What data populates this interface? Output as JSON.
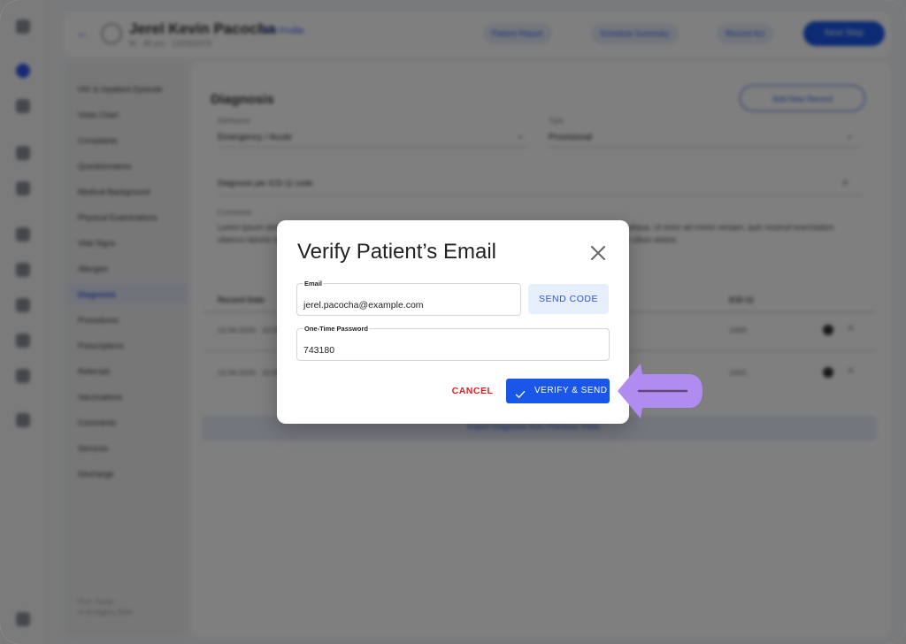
{
  "background": {
    "patient_name": "Jerel Kevin Pacocha",
    "patient_meta": "M · 45 yrs · 12/03/1979",
    "visit_chip": "Visit Profile",
    "header_buttons": [
      "Patient Report",
      "Schedule Summary",
      "Record Act"
    ],
    "primary_button": "Next Step",
    "nav_items": [
      "HIV & Inpatient Episode",
      "Visits Chart",
      "Complaints",
      "Questionnaires",
      "Medical Background",
      "Physical Examinations",
      "Vital Signs",
      "Allergies",
      "Diagnosis",
      "Procedures",
      "Prescriptions",
      "Referrals",
      "Vaccinations",
      "Comments",
      "Services",
      "Discharge"
    ],
    "nav_selected": "Diagnosis",
    "nav_footer": [
      "Prof. Portal",
      "© All Rights 2024"
    ],
    "main_title": "Diagnosis",
    "add_button": "Add New Record",
    "field1_label": "Admission",
    "field1_value": "Emergency / Acute",
    "field2_label": "Type",
    "field2_value": "Provisional",
    "search_text": "Diagnosis per ICD-11 code",
    "comments_label": "Comments",
    "comments_text": "Lorem ipsum dolor sit amet, consectetur adipiscing elit, sed do eiusmod tempor incididunt ut labore et dolore magna aliqua. Ut enim ad minim veniam, quis nostrud exercitation ullamco laboris nisi ut aliquip ex ea commodo consequat. Duis aute irure dolor in reprehenderit in voluptate velit esse cillum dolore.",
    "table_headers": [
      "Record Date",
      "ICD-11"
    ],
    "table_rows": [
      [
        "12.04.2024 · 10:32",
        "1A00"
      ],
      [
        "12.04.2024 · 10:40",
        "1A01"
      ]
    ],
    "band_text": "Import Diagnosis from Previous Visits"
  },
  "dialog": {
    "title": "Verify Patient’s Email",
    "email_label": "Email",
    "email_value": "jerel.pacocha@example.com",
    "send_code_label": "SEND CODE",
    "otp_label": "One-Time Password",
    "otp_value": "743180",
    "cancel_label": "CANCEL",
    "verify_label": "VERIFY & SEND",
    "icons": {
      "close": "close-icon",
      "confirm": "check-icon",
      "callout": "arrow-left-icon"
    }
  },
  "colors": {
    "primary": "#1a56e8",
    "primary_light": "#e7eefc",
    "danger": "#e02020",
    "callout": "#b18cf0"
  }
}
